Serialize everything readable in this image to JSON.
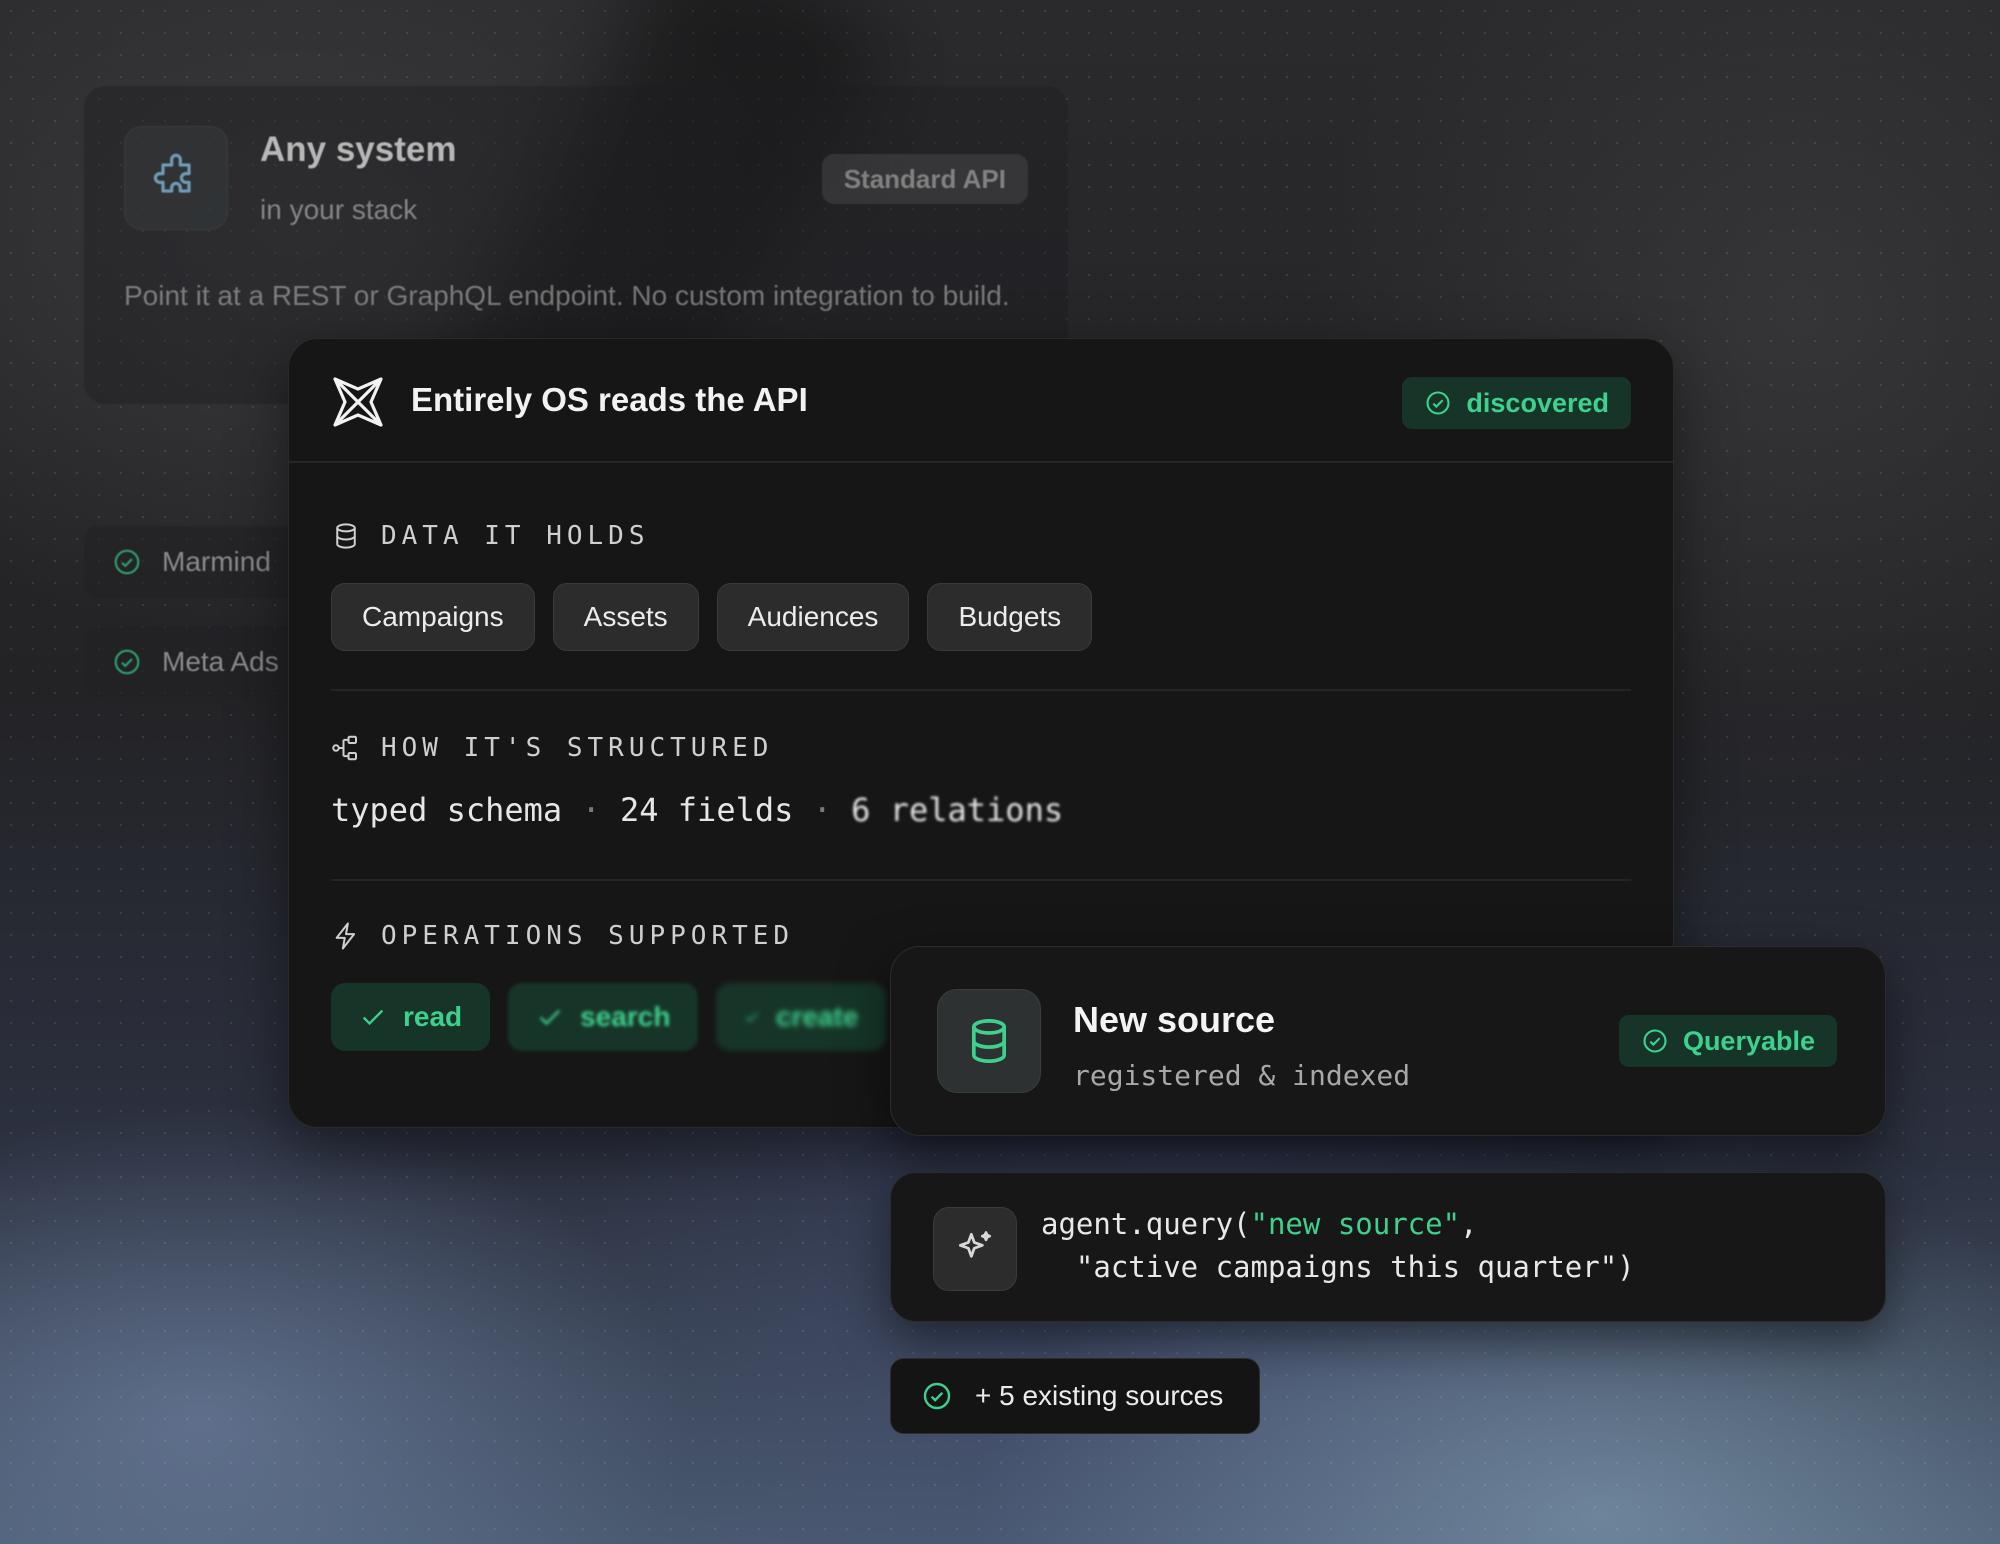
{
  "background_card": {
    "title": "Any system",
    "subtitle": "in your stack",
    "badge": "Standard API",
    "description": "Point it at a REST or GraphQL endpoint. No custom integration to build.",
    "icon": "puzzle-icon"
  },
  "side_sources": [
    {
      "label": "Marmind",
      "icon": "check-circle-icon"
    },
    {
      "label": "Meta Ads",
      "icon": "check-circle-icon"
    }
  ],
  "main_card": {
    "title": "Entirely OS reads the API",
    "status": "discovered",
    "sections": {
      "data": {
        "label": "DATA IT HOLDS",
        "icon": "database-icon",
        "items": [
          "Campaigns",
          "Assets",
          "Audiences",
          "Budgets"
        ]
      },
      "structure": {
        "label": "HOW IT'S STRUCTURED",
        "icon": "tree-structure-icon",
        "schema": "typed schema",
        "fields": "24 fields",
        "relations": "6 relations",
        "separator": "·"
      },
      "operations": {
        "label": "OPERATIONS SUPPORTED",
        "icon": "lightning-icon",
        "items": [
          "read",
          "search",
          "create"
        ]
      }
    }
  },
  "new_source": {
    "title": "New source",
    "subtitle": "registered & indexed",
    "status": "Queryable",
    "icon": "database-icon"
  },
  "query": {
    "icon": "sparkle-icon",
    "line1_prefix": "agent.query(",
    "line1_string": "\"new source\"",
    "line1_suffix": ",",
    "line2": "  \"active campaigns this quarter\")"
  },
  "existing": {
    "label": "+ 5 existing sources",
    "icon": "check-circle-icon"
  },
  "colors": {
    "accent_green": "#3ed18e",
    "badge_green_bg": "#163528",
    "card_bg": "#161616"
  }
}
